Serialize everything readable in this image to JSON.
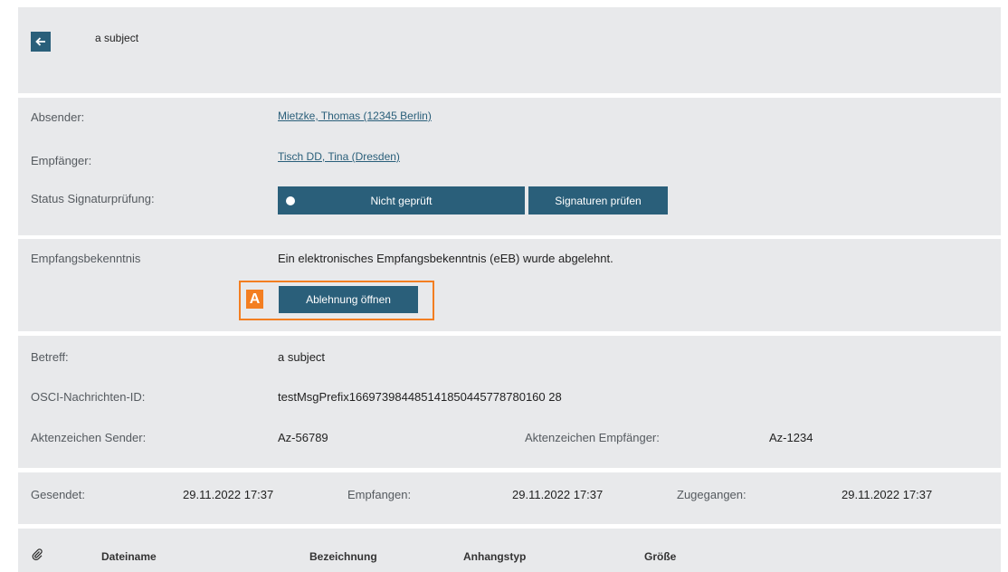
{
  "header": {
    "back_icon": "arrow-left-icon",
    "title": "a subject"
  },
  "parties": {
    "sender_label": "Absender:",
    "sender_value": "Mietzke, Thomas (12345 Berlin)",
    "recipient_label": "Empfänger:",
    "recipient_value": "Tisch DD, Tina (Dresden)",
    "signature_label": "Status Signaturprüfung:",
    "signature_status": "Nicht geprüft",
    "check_signatures_button": "Signaturen prüfen"
  },
  "receipt": {
    "label": "Empfangsbekenntnis",
    "message": "Ein elektronisches Empfangsbekenntnis (eEB) wurde abgelehnt.",
    "open_rejection_button": "Ablehnung öffnen",
    "marker": "A",
    "highlight_color": "#f37e21"
  },
  "details": {
    "subject_label": "Betreff:",
    "subject_value": "a subject",
    "osci_label": "OSCI-Nachrichten-ID:",
    "osci_value": "testMsgPrefix166973984485141850445778780160 28",
    "sender_ref_label": "Aktenzeichen Sender:",
    "sender_ref_value": "Az-56789",
    "recipient_ref_label": "Aktenzeichen Empfänger:",
    "recipient_ref_value": "Az-1234"
  },
  "timestamps": {
    "sent_label": "Gesendet:",
    "sent_value": "29.11.2022 17:37",
    "received_label": "Empfangen:",
    "received_value": "29.11.2022 17:37",
    "delivered_label": "Zugegangen:",
    "delivered_value": "29.11.2022 17:37"
  },
  "attachments": {
    "icon": "paperclip-icon",
    "columns": [
      "Dateiname",
      "Bezeichnung",
      "Anhangstyp",
      "Größe"
    ]
  },
  "colors": {
    "primary": "#2a5f7a",
    "panel": "#e8e9eb",
    "accent": "#f37e21"
  }
}
